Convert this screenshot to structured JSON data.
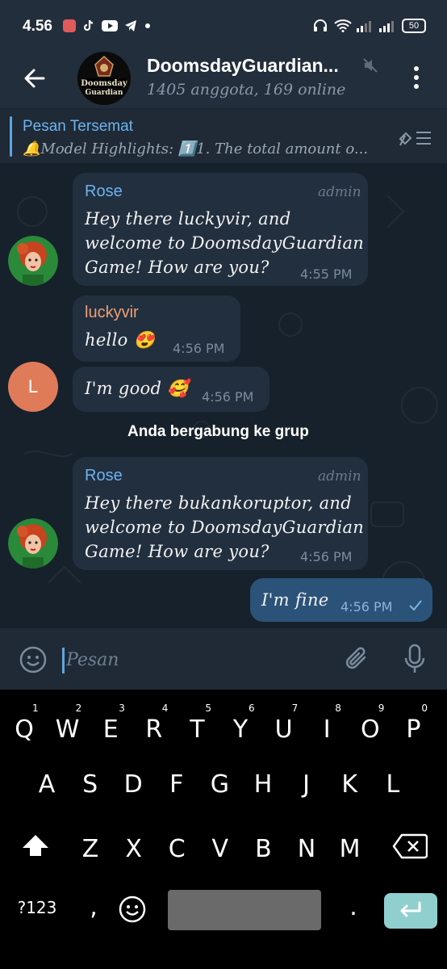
{
  "status_bar": {
    "time": "4.56",
    "battery": "50"
  },
  "header": {
    "title": "DoomsdayGuardian...",
    "subtitle": "1405 anggota, 169 online",
    "avatar_text_line1": "Doomsday",
    "avatar_text_line2": "Guardian"
  },
  "pinned": {
    "title": "Pesan Tersemat",
    "text": "🔔Model Highlights: 1️⃣1. The total amount o..."
  },
  "messages": [
    {
      "sender": "Rose",
      "role": "admin",
      "lines": [
        "Hey there luckyvir, and",
        "welcome to DoomsdayGuardian",
        "Game! How are you?"
      ],
      "time": "4:55 PM"
    },
    {
      "sender": "luckyvir",
      "lines": [
        "hello 😍"
      ],
      "time": "4:56 PM"
    },
    {
      "avatar_letter": "L",
      "lines": [
        "I'm good 🥰"
      ],
      "time": "4:56 PM"
    },
    {
      "system": "Anda bergabung ke grup"
    },
    {
      "sender": "Rose",
      "role": "admin",
      "lines": [
        "Hey there bukankoruptor, and",
        "welcome to DoomsdayGuardian",
        "Game! How are you?"
      ],
      "time": "4:56 PM"
    },
    {
      "lines": [
        "I'm fine"
      ],
      "time": "4:56 PM",
      "outgoing": true
    }
  ],
  "input": {
    "placeholder": "Pesan"
  },
  "keyboard": {
    "row1": [
      "Q",
      "W",
      "E",
      "R",
      "T",
      "Y",
      "U",
      "I",
      "O",
      "P"
    ],
    "row1_hints": [
      "1",
      "2",
      "3",
      "4",
      "5",
      "6",
      "7",
      "8",
      "9",
      "0"
    ],
    "row2": [
      "A",
      "S",
      "D",
      "F",
      "G",
      "H",
      "J",
      "K",
      "L"
    ],
    "row3": [
      "Z",
      "X",
      "C",
      "V",
      "B",
      "N",
      "M"
    ],
    "symbols_key": "?123",
    "comma_key": ",",
    "period_key": "."
  },
  "colors": {
    "accent": "#5ea6e0",
    "name_rose": "#6cb3ee",
    "name_luckyvir": "#f0a070",
    "avatar_L": "#e07b5a",
    "enter_key": "#8fd0cf"
  }
}
